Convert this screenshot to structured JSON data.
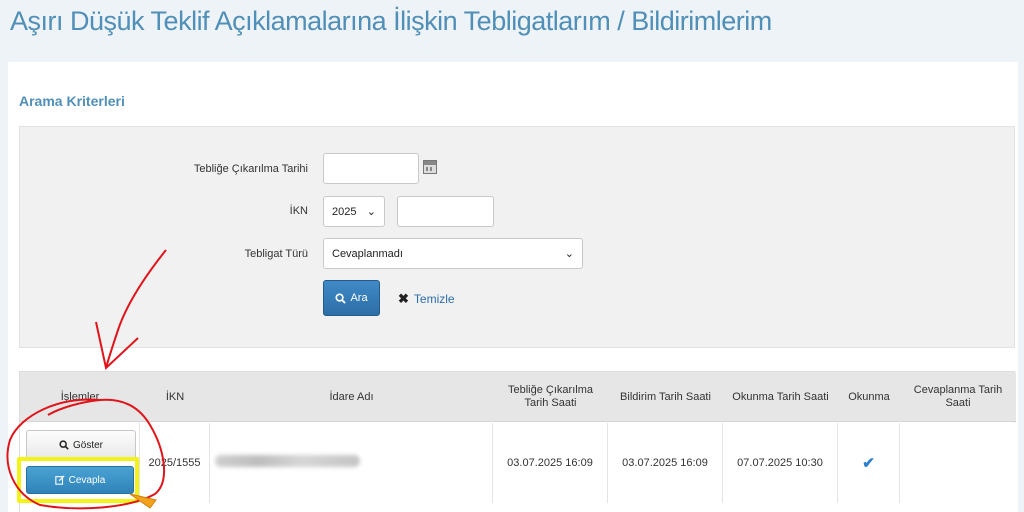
{
  "page_title": "Aşırı Düşük Teklif Açıklamalarına İlişkin Tebligatlarım / Bildirimlerim",
  "section_title": "Arama Kriterleri",
  "form": {
    "date_label": "Tebliğe Çıkarılma Tarihi",
    "date_value": "",
    "ikn_label": "İKN",
    "ikn_year": "2025",
    "ikn_value": "",
    "type_label": "Tebligat Türü",
    "type_value": "Cevaplanmadı",
    "search_label": "Ara",
    "clear_label": "Temizle"
  },
  "table": {
    "headers": [
      "İşlemler",
      "İKN",
      "İdare Adı",
      "Tebliğe Çıkarılma Tarih Saati",
      "Bildirim Tarih Saati",
      "Okunma Tarih Saati",
      "Okunma",
      "Cevaplanma Tarih Saati"
    ],
    "rows": [
      {
        "show_label": "Göster",
        "reply_label": "Cevapla",
        "ikn": "2025/1555",
        "idare_adi": "",
        "teblig_date": "03.07.2025 16:09",
        "bildirim_date": "03.07.2025 16:09",
        "okunma_date": "07.07.2025 10:30",
        "okunma": "read",
        "cevaplanma_date": ""
      }
    ]
  },
  "colors": {
    "title": "#4f8fb8",
    "primary_button": "#2d6ea8",
    "reply_button": "#3b93c8",
    "highlight": "#f3f31a",
    "annotation": "#e0141b"
  }
}
